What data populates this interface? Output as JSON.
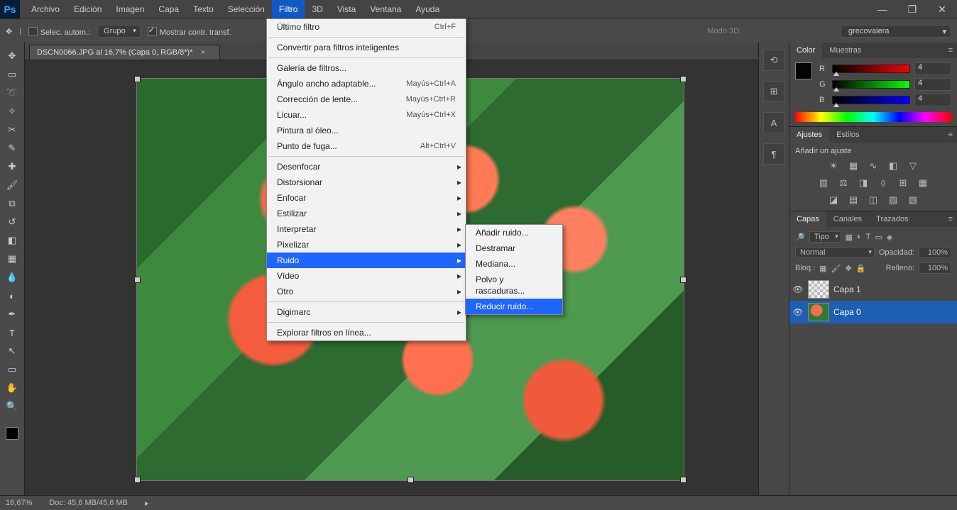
{
  "app_logo": "Ps",
  "menubar": [
    "Archivo",
    "Edición",
    "Imagen",
    "Capa",
    "Texto",
    "Selección",
    "Filtro",
    "3D",
    "Vista",
    "Ventana",
    "Ayuda"
  ],
  "menubar_open_index": 6,
  "window_controls": {
    "min": "—",
    "max": "❐",
    "close": "✕"
  },
  "options_bar": {
    "auto_select_label": "Selec. autom.:",
    "group_dropdown": "Grupo",
    "show_transform": "Mostrar contr. transf.",
    "mode3d_label": "Modo 3D:",
    "account": "grecovalera"
  },
  "document_tab": {
    "title": "DSCN0066.JPG al 16,7% (Capa 0, RGB/8*)",
    "modified": "*",
    "close": "×"
  },
  "filter_menu": {
    "items": [
      {
        "label": "Último filtro",
        "shortcut": "Ctrl+F"
      },
      {
        "sep": true
      },
      {
        "label": "Convertir para filtros inteligentes"
      },
      {
        "sep": true
      },
      {
        "label": "Galería de filtros..."
      },
      {
        "label": "Ángulo ancho adaptable...",
        "shortcut": "Mayús+Ctrl+A"
      },
      {
        "label": "Corrección de lente...",
        "shortcut": "Mayús+Ctrl+R"
      },
      {
        "label": "Licuar...",
        "shortcut": "Mayús+Ctrl+X"
      },
      {
        "label": "Pintura al óleo..."
      },
      {
        "label": "Punto de fuga...",
        "shortcut": "Alt+Ctrl+V"
      },
      {
        "sep": true
      },
      {
        "label": "Desenfocar",
        "sub": true
      },
      {
        "label": "Distorsionar",
        "sub": true
      },
      {
        "label": "Enfocar",
        "sub": true
      },
      {
        "label": "Estilizar",
        "sub": true
      },
      {
        "label": "Interpretar",
        "sub": true
      },
      {
        "label": "Pixelizar",
        "sub": true
      },
      {
        "label": "Ruido",
        "sub": true,
        "hl": true
      },
      {
        "label": "Vídeo",
        "sub": true
      },
      {
        "label": "Otro",
        "sub": true
      },
      {
        "sep": true
      },
      {
        "label": "Digimarc",
        "sub": true
      },
      {
        "sep": true
      },
      {
        "label": "Explorar filtros en línea..."
      }
    ]
  },
  "noise_submenu": {
    "items": [
      {
        "label": "Añadir ruido..."
      },
      {
        "label": "Destramar"
      },
      {
        "label": "Mediana..."
      },
      {
        "label": "Polvo y rascaduras..."
      },
      {
        "label": "Reducir ruido...",
        "hl": true
      }
    ]
  },
  "panels": {
    "color": {
      "tabs": [
        "Color",
        "Muestras"
      ],
      "r_label": "R",
      "g_label": "G",
      "b_label": "B",
      "r": "4",
      "g": "4",
      "b": "4"
    },
    "adjust": {
      "tabs": [
        "Ajustes",
        "Estilos"
      ],
      "title": "Añadir un ajuste"
    },
    "layers": {
      "tabs": [
        "Capas",
        "Canales",
        "Trazados"
      ],
      "kind_label": "Tipo",
      "blend": "Normal",
      "opacity_label": "Opacidad:",
      "opacity": "100%",
      "lock_label": "Bloq.:",
      "fill_label": "Relleno:",
      "fill": "100%",
      "items": [
        {
          "name": "Capa 1",
          "img": false,
          "on": false
        },
        {
          "name": "Capa 0",
          "img": true,
          "on": true
        }
      ]
    }
  },
  "status": {
    "zoom": "16,67%",
    "doc": "Doc: 45,6 MB/45,6 MB"
  }
}
